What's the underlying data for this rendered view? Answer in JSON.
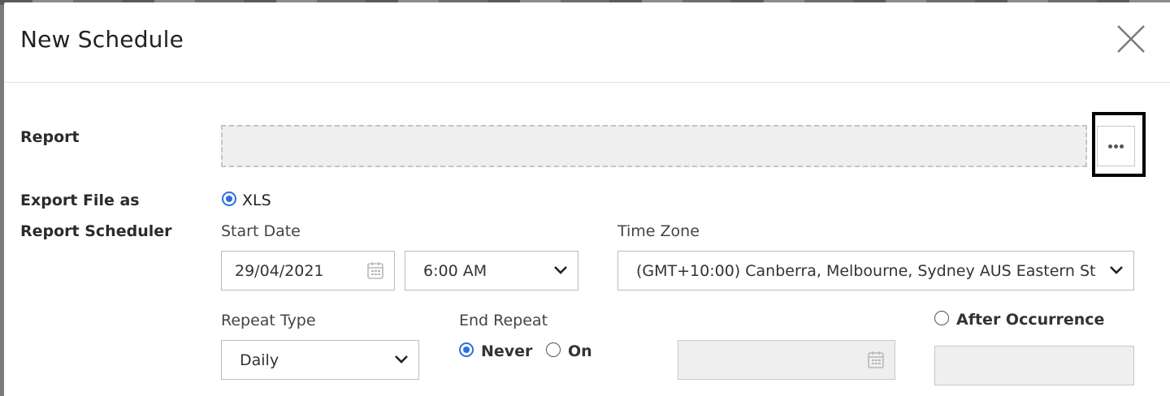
{
  "modal": {
    "title": "New Schedule",
    "close_icon": "close-icon"
  },
  "report": {
    "label": "Report",
    "value": "",
    "browse_icon": "ellipsis-icon"
  },
  "export": {
    "label": "Export File as",
    "options": [
      {
        "label": "XLS",
        "checked": true
      }
    ]
  },
  "scheduler": {
    "label": "Report Scheduler",
    "start_date": {
      "label": "Start Date",
      "value": "29/04/2021",
      "icon": "calendar-icon"
    },
    "start_time": {
      "value": "6:00 AM"
    },
    "time_zone": {
      "label": "Time Zone",
      "value": "(GMT+10:00) Canberra, Melbourne, Sydney AUS Eastern St"
    },
    "repeat_type": {
      "label": "Repeat Type",
      "value": "Daily"
    },
    "end_repeat": {
      "label": "End Repeat",
      "options": [
        {
          "label": "Never",
          "checked": true
        },
        {
          "label": "On",
          "checked": false
        }
      ],
      "on_date_value": "",
      "on_date_icon": "calendar-icon"
    },
    "after_occurrence": {
      "label": "After Occurrence",
      "checked": false,
      "value": ""
    }
  },
  "colors": {
    "accent": "#2f6ee0",
    "disabled_bg": "#efefef",
    "highlight": "#000000"
  }
}
